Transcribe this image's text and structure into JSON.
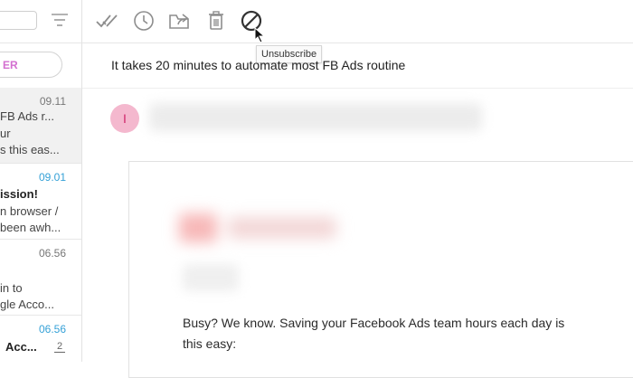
{
  "filter_pill": {
    "label": "ER"
  },
  "toolbar": {
    "icons": [
      "mark-read-icon",
      "snooze-icon",
      "move-icon",
      "delete-icon",
      "unsubscribe-icon"
    ],
    "tooltip": "Unsubscribe"
  },
  "list": {
    "items": [
      {
        "time": "09.11",
        "lines": [
          "FB Ads r...",
          "ur",
          "s this eas..."
        ],
        "selected": true,
        "time_color": "#777777"
      },
      {
        "time": "09.01",
        "lines": [
          "ission!",
          "n browser /",
          "been awh..."
        ],
        "selected": false,
        "time_color": "#35a1d7"
      },
      {
        "time": "06.56",
        "lines": [
          "",
          "in to",
          "gle Acco..."
        ],
        "selected": false,
        "time_color": "#777777"
      },
      {
        "time": "06.56",
        "lines": [
          "Acc...",
          ""
        ],
        "selected": false,
        "time_color": "#35a1d7",
        "badge": "2"
      }
    ]
  },
  "message": {
    "subject": "It takes 20 minutes to automate most FB Ads routine",
    "sender_initial": "I",
    "body_line1": "Busy? We know. Saving your Facebook Ads team hours each day is",
    "body_line2": "this easy:"
  },
  "colors": {
    "accent_pink": "#d36fd0",
    "link_blue": "#35a1d7",
    "avatar_bg": "#f4b8ce",
    "avatar_fg": "#d0266a"
  }
}
